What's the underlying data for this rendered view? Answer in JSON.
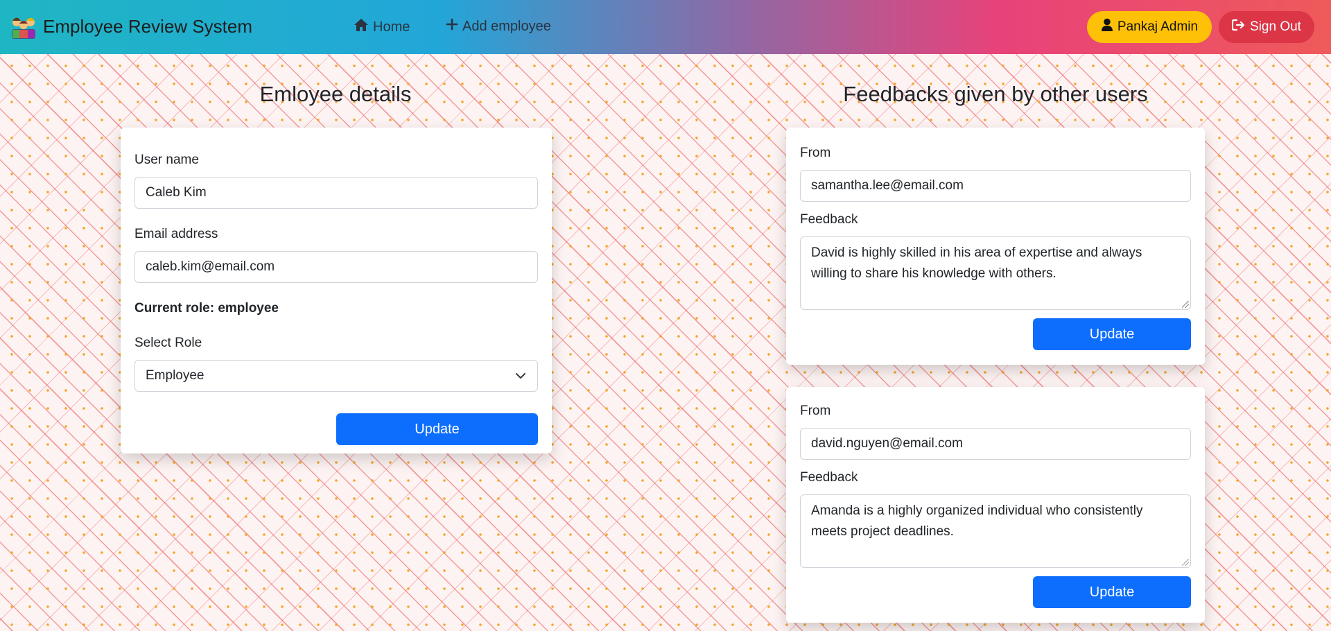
{
  "navbar": {
    "brand_title": "Employee Review System",
    "home_label": "Home",
    "add_employee_label": "Add employee",
    "user_button_label": "Pankaj Admin",
    "signout_label": "Sign Out",
    "colors": {
      "user_button": "#ffc107",
      "signout_button": "#dc3545"
    }
  },
  "employee_details": {
    "title": "Emloyee details",
    "username_label": "User name",
    "username_value": "Caleb Kim",
    "email_label": "Email address",
    "email_value": "caleb.kim@email.com",
    "current_role": "Current role: employee",
    "select_role_label": "Select Role",
    "select_role_value": "Employee",
    "update_label": "Update"
  },
  "feedbacks": {
    "title": "Feedbacks given by other users",
    "items": [
      {
        "from_label": "From",
        "from_value": "samantha.lee@email.com",
        "feedback_label": "Feedback",
        "feedback_text": "David is highly skilled in his area of expertise and always willing to share his knowledge with others.",
        "update_label": "Update"
      },
      {
        "from_label": "From",
        "from_value": "david.nguyen@email.com",
        "feedback_label": "Feedback",
        "feedback_text": "Amanda is a highly organized individual who consistently meets project deadlines.",
        "update_label": "Update"
      }
    ]
  },
  "theme": {
    "primary": "#0d6efd"
  }
}
